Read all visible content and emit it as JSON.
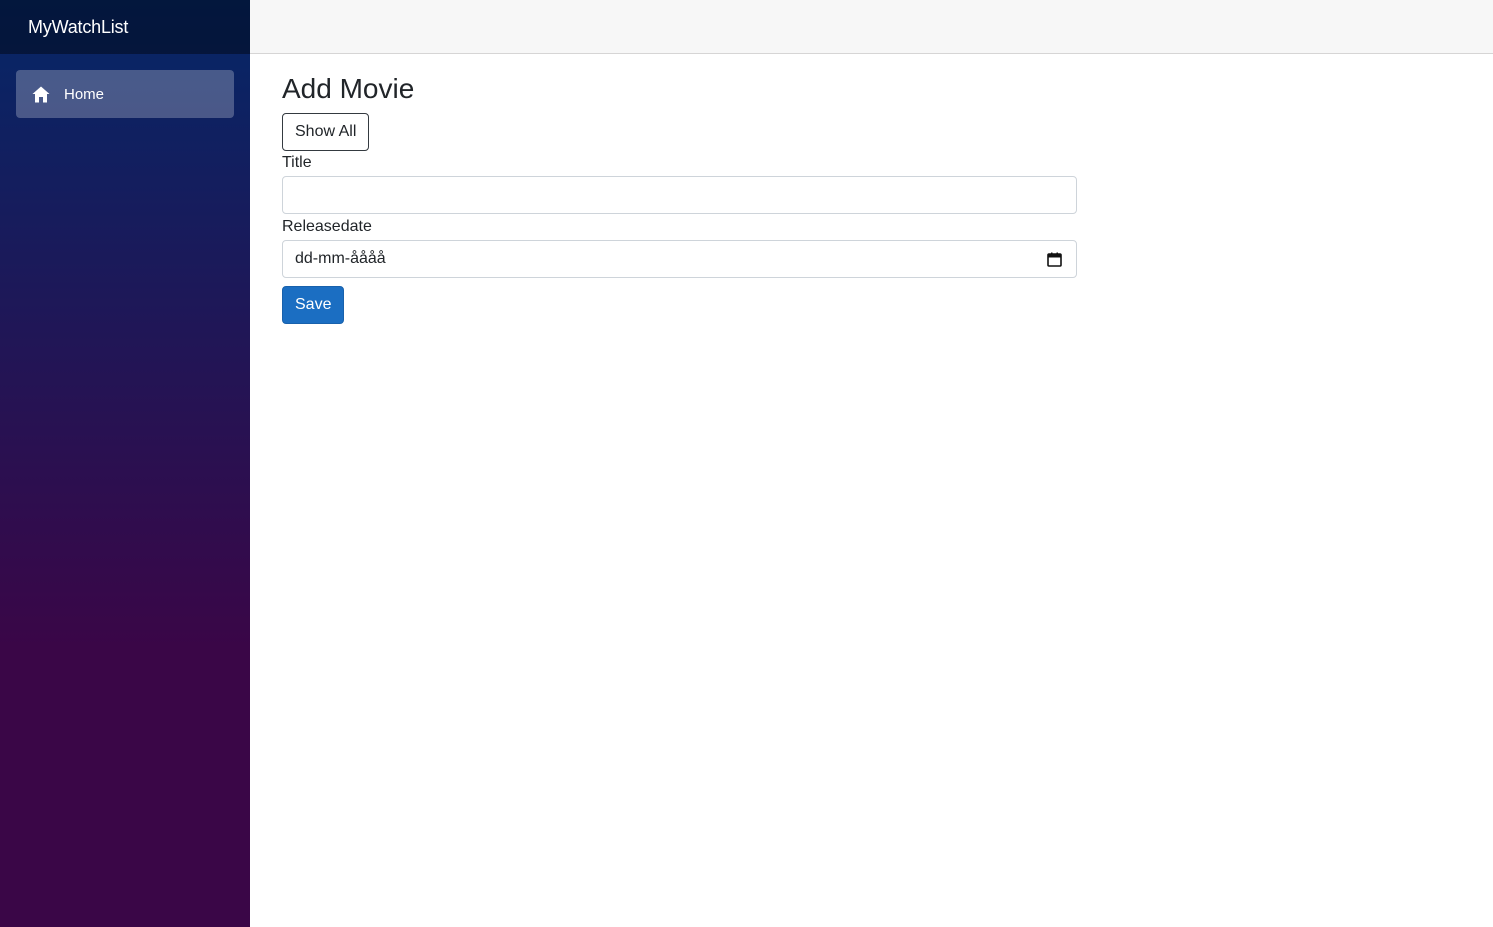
{
  "app": {
    "brand": "MyWatchList"
  },
  "sidebar": {
    "items": [
      {
        "label": "Home",
        "icon": "home-icon",
        "active": true
      }
    ]
  },
  "main": {
    "title": "Add Movie",
    "show_all_label": "Show All",
    "fields": {
      "title_label": "Title",
      "title_value": "",
      "releasedate_label": "Releasedate",
      "releasedate_value": "dd-mm-åååå"
    },
    "save_label": "Save"
  },
  "colors": {
    "sidebar_top": "#052767",
    "sidebar_bottom": "#3a0647",
    "primary_button": "#1b6ec2",
    "topbar": "#f7f7f7"
  }
}
